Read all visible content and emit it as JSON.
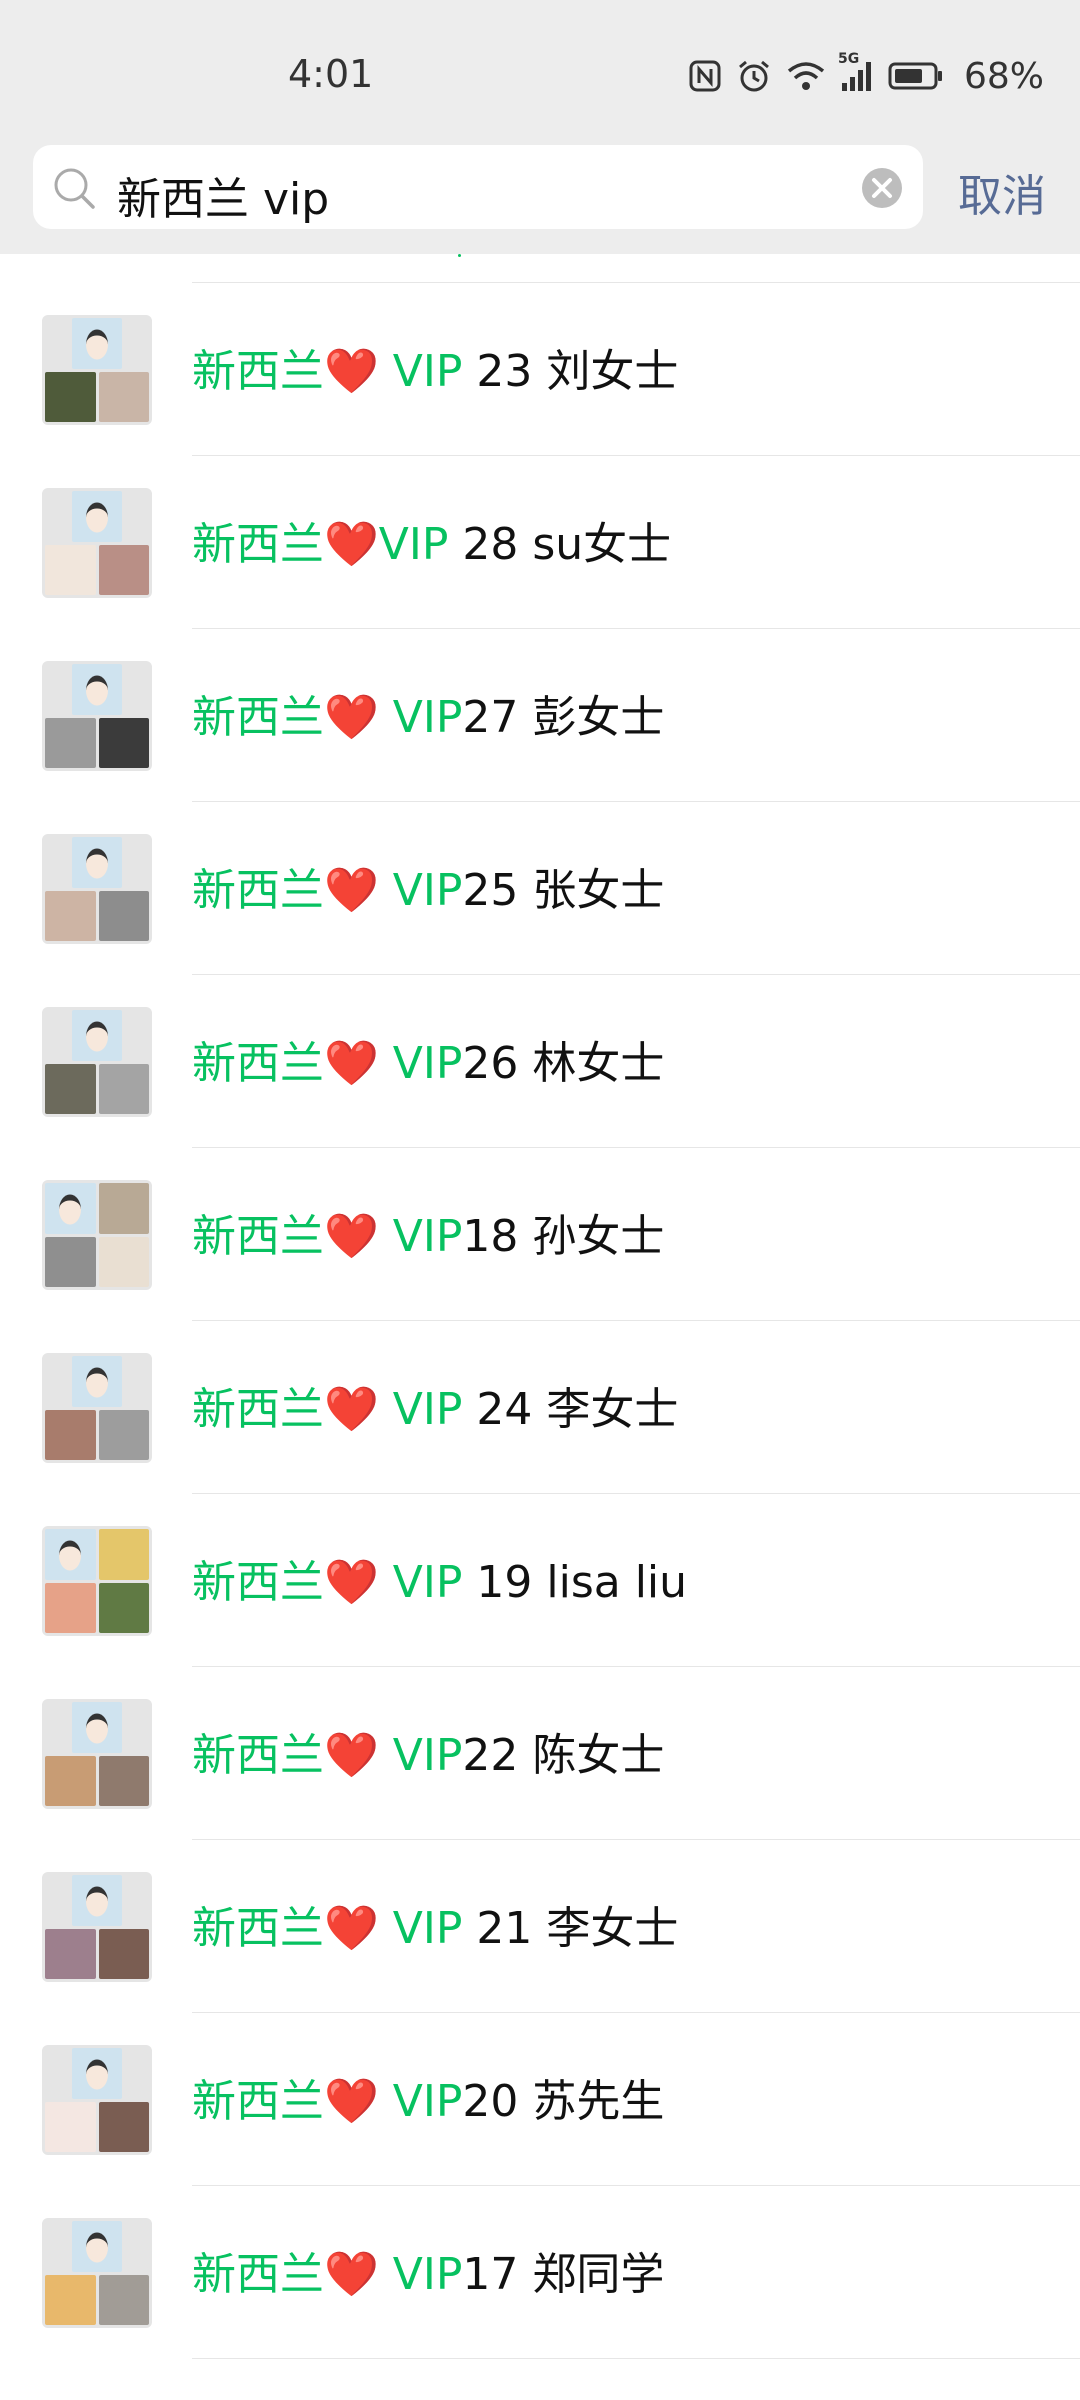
{
  "status_bar": {
    "time": "4:01",
    "network": "5G",
    "battery": "68%",
    "icons": [
      "nfc-icon",
      "alarm-icon",
      "wifi-icon",
      "signal-icon",
      "battery-icon"
    ]
  },
  "search": {
    "query": "新西兰 vip",
    "cancel_label": "取消"
  },
  "colors": {
    "highlight": "#07c160",
    "cancel": "#576b95",
    "heart": "#e02424"
  },
  "results": [
    {
      "prefix": "新西兰",
      "heart": "❤️",
      "hl": " VIP",
      "rest": " 23  刘女士",
      "cells": [
        "#4f5b3a",
        "#c9b5a7"
      ]
    },
    {
      "prefix": "新西兰",
      "heart": "❤️",
      "hl": "VIP",
      "rest": " 28    su女士",
      "cells": [
        "#f1e6dc",
        "#b98f86"
      ]
    },
    {
      "prefix": "新西兰",
      "heart": "❤️",
      "hl": " VIP",
      "rest": "27  彭女士",
      "cells": [
        "#9a9a9a",
        "#3b3b3b"
      ]
    },
    {
      "prefix": "新西兰",
      "heart": "❤️",
      "hl": " VIP",
      "rest": "25  张女士",
      "cells": [
        "#cdb4a4",
        "#8d8d8d"
      ]
    },
    {
      "prefix": "新西兰",
      "heart": "❤️",
      "hl": " VIP",
      "rest": "26 林女士",
      "cells": [
        "#6c6a5c",
        "#a4a4a4"
      ]
    },
    {
      "prefix": "新西兰",
      "heart": "❤️",
      "hl": " VIP",
      "rest": "18  孙女士",
      "cells": [
        "#8f8f8f",
        "#e9dfd2"
      ],
      "four": true,
      "cell0": "#b8a995"
    },
    {
      "prefix": "新西兰",
      "heart": "❤️",
      "hl": " VIP",
      "rest": " 24 李女士",
      "cells": [
        "#a87c6c",
        "#9d9d9d"
      ]
    },
    {
      "prefix": "新西兰",
      "heart": "❤️",
      "hl": " VIP",
      "rest": " 19  lisa liu",
      "cells": [
        "#e6a288",
        "#607a44"
      ],
      "four": true,
      "cell0": "#e4c66a"
    },
    {
      "prefix": "新西兰",
      "heart": "❤️",
      "hl": " VIP",
      "rest": "22 陈女士",
      "cells": [
        "#c89c74",
        "#8f7a6d"
      ]
    },
    {
      "prefix": "新西兰",
      "heart": "❤️",
      "hl": " VIP",
      "rest": " 21  李女士",
      "cells": [
        "#9d7f8d",
        "#7a5d52"
      ]
    },
    {
      "prefix": "新西兰",
      "heart": "❤️",
      "hl": " VIP",
      "rest": "20  苏先生",
      "cells": [
        "#f4e7e2",
        "#7a5d52"
      ]
    },
    {
      "prefix": "新西兰",
      "heart": "❤️",
      "hl": " VIP",
      "rest": "17   郑同学",
      "cells": [
        "#e8b86b",
        "#a19c96"
      ]
    }
  ]
}
